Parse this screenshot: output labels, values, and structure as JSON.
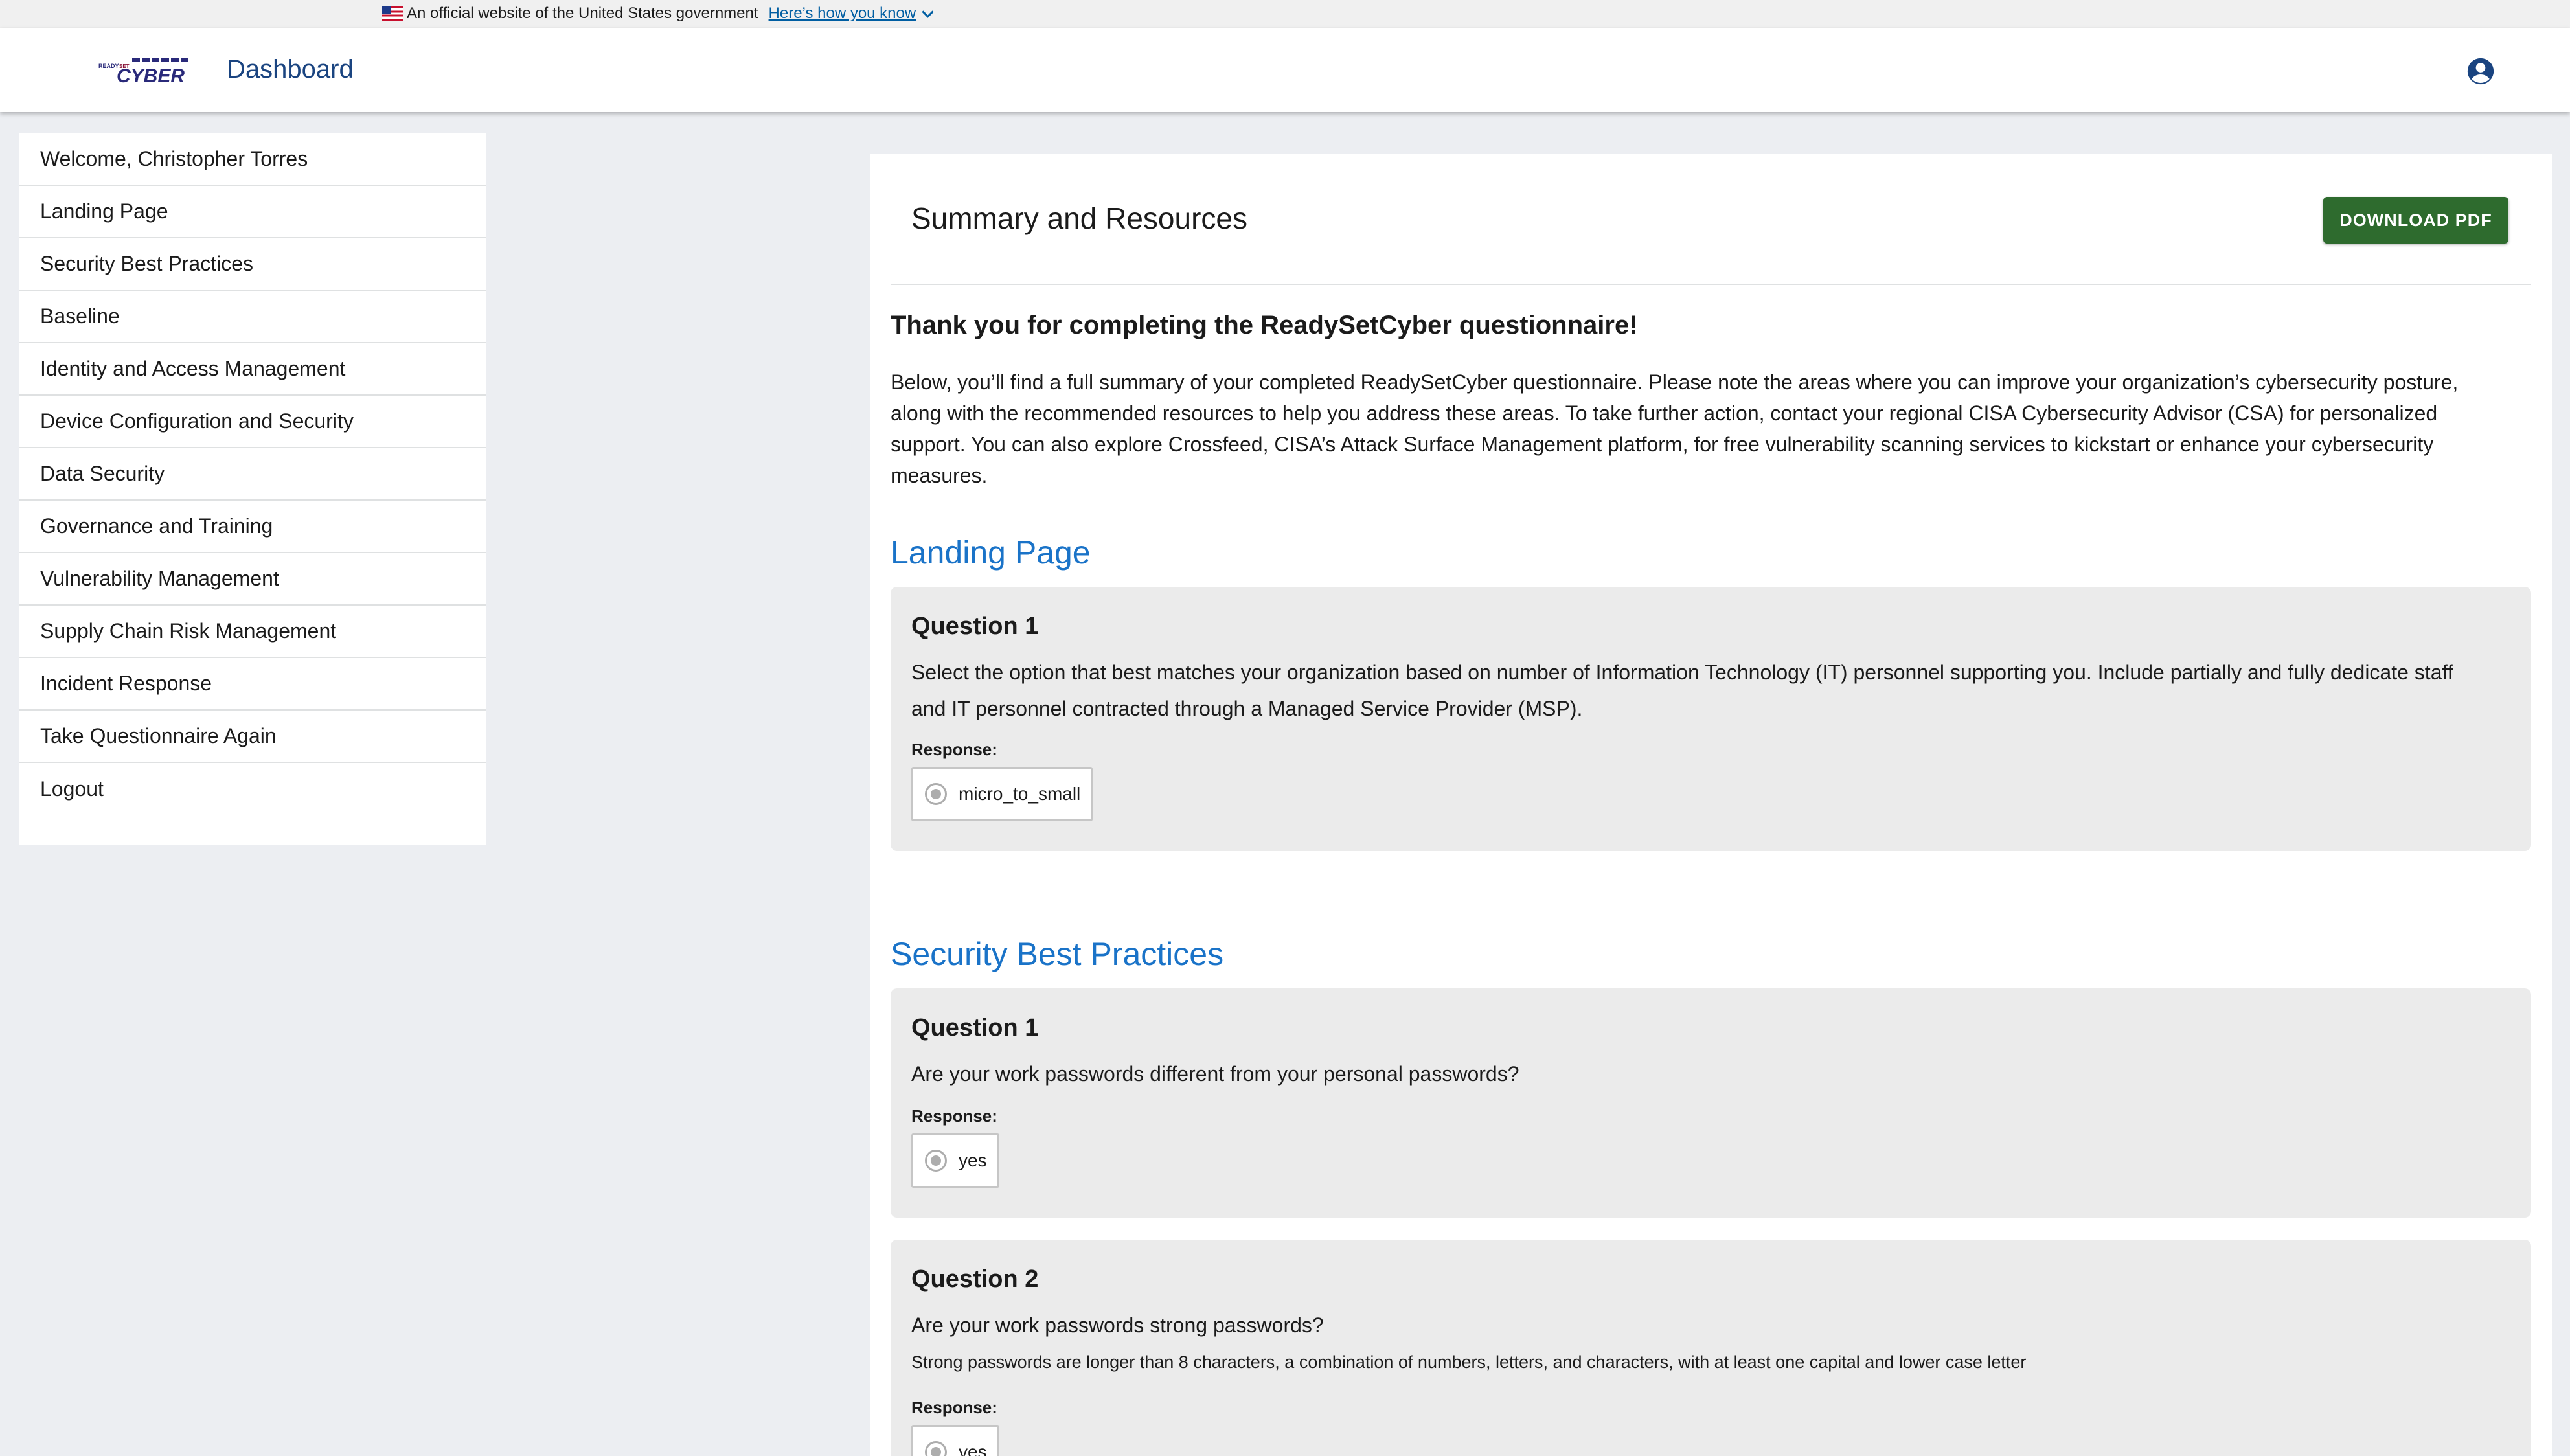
{
  "banner": {
    "official_text": "An official website of the United States government",
    "how_link": "Here’s how you know"
  },
  "header": {
    "logo_text": "READY SET CYBER",
    "title": "Dashboard",
    "account_icon": "account-circle-icon"
  },
  "sidebar": {
    "items": [
      {
        "label": "Welcome, Christopher Torres"
      },
      {
        "label": "Landing Page"
      },
      {
        "label": "Security Best Practices"
      },
      {
        "label": "Baseline"
      },
      {
        "label": "Identity and Access Management"
      },
      {
        "label": "Device Configuration and Security"
      },
      {
        "label": "Data Security"
      },
      {
        "label": "Governance and Training"
      },
      {
        "label": "Vulnerability Management"
      },
      {
        "label": "Supply Chain Risk Management"
      },
      {
        "label": "Incident Response"
      },
      {
        "label": "Take Questionnaire Again"
      },
      {
        "label": "Logout"
      }
    ]
  },
  "main": {
    "title": "Summary and Resources",
    "download_label": "DOWNLOAD PDF",
    "thanks": "Thank you for completing the ReadySetCyber questionnaire!",
    "intro": "Below, you’ll find a full summary of your completed ReadySetCyber questionnaire. Please note the areas where you can improve your organization’s cybersecurity posture, along with the recommended resources to help you address these areas. To take further action, contact your regional CISA Cybersecurity Advisor (CSA) for personalized support. You can also explore Crossfeed, CISA’s Attack Surface Management platform, for free vulnerability scanning services to kickstart or enhance your cybersecurity measures.",
    "sections": [
      {
        "title": "Landing Page",
        "questions": [
          {
            "title": "Question 1",
            "text": "Select the option that best matches your organization based on number of Information Technology (IT) personnel supporting you. Include partially and fully dedicate staff and IT personnel contracted through a Managed Service Provider (MSP).",
            "response_label": "Response:",
            "response": "micro_to_small"
          }
        ]
      },
      {
        "title": "Security Best Practices",
        "questions": [
          {
            "title": "Question 1",
            "text": "Are your work passwords different from your personal passwords?",
            "response_label": "Response:",
            "response": "yes"
          },
          {
            "title": "Question 2",
            "text": "Are your work passwords strong passwords?",
            "help": "Strong passwords are longer than 8 characters, a combination of numbers, letters, and characters, with at least one capital and lower case letter",
            "response_label": "Response:",
            "response": "yes"
          }
        ]
      }
    ]
  },
  "colors": {
    "accent_blue": "#1a73c8",
    "header_title": "#1a4480",
    "download_green": "#2e6b2e",
    "page_bg": "#eceef2"
  }
}
